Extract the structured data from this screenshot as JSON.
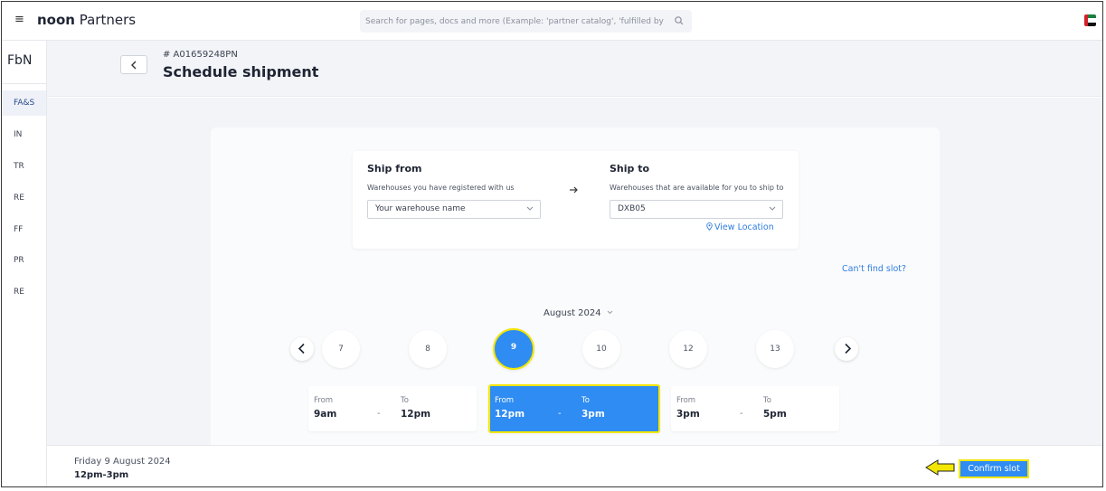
{
  "topbar": {
    "brand_bold": "noon",
    "brand_rest": " Partners",
    "search_placeholder": "Search for pages, docs and more (Example: 'partner catalog', 'fulfilled by p",
    "menu_icon": "hamburger-icon",
    "search_icon": "search-icon",
    "flag_icon": "uae-flag-icon"
  },
  "sidebar": {
    "title": "FbN",
    "items": [
      {
        "label": "FA&S",
        "active": true
      },
      {
        "label": "IN",
        "active": false
      },
      {
        "label": "TR",
        "active": false
      },
      {
        "label": "RE",
        "active": false
      },
      {
        "label": "FF",
        "active": false
      },
      {
        "label": "PR",
        "active": false
      },
      {
        "label": "RE",
        "active": false
      }
    ]
  },
  "header": {
    "reference": "# A01659248PN",
    "title": "Schedule shipment"
  },
  "ship": {
    "from_label": "Ship from",
    "from_sub": "Warehouses you have registered with us",
    "from_value": "Your warehouse name",
    "to_label": "Ship to",
    "to_sub": "Warehouses that are available for you to ship to",
    "to_value": "DXB05",
    "view_location": "View Location"
  },
  "cant_find_slot": "Can't find slot?",
  "calendar": {
    "month": "August 2024",
    "days": [
      "7",
      "8",
      "9",
      "10",
      "12",
      "13"
    ],
    "selected_day": "9"
  },
  "slots": [
    {
      "from_label": "From",
      "from": "9am",
      "to_label": "To",
      "to": "12pm",
      "selected": false
    },
    {
      "from_label": "From",
      "from": "12pm",
      "to_label": "To",
      "to": "3pm",
      "selected": true
    },
    {
      "from_label": "From",
      "from": "3pm",
      "to_label": "To",
      "to": "5pm",
      "selected": false
    }
  ],
  "footer": {
    "date": "Friday 9 August 2024",
    "time": "12pm-3pm",
    "confirm_label": "Confirm slot"
  },
  "colors": {
    "accent": "#2f8cf2",
    "highlight": "#f3e600",
    "link": "#2f7de1"
  }
}
